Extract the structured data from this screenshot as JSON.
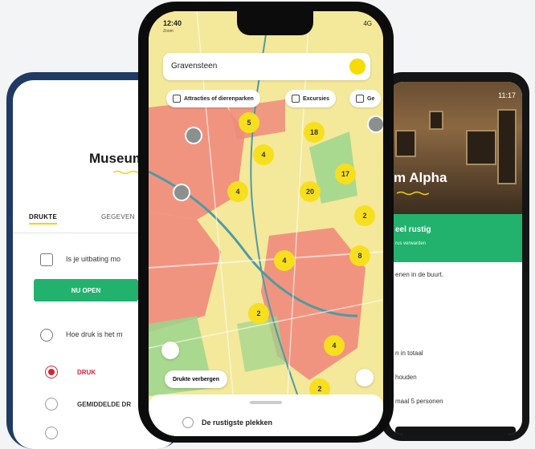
{
  "left_app": {
    "title": "Museum",
    "tabs": [
      {
        "label": "DRUKTE"
      },
      {
        "label": "GEGEVEN"
      }
    ],
    "operator_question": "Is je uitbating mo",
    "open_button": "NU OPEN",
    "crowd_question": "Hoe druk is het m",
    "options": [
      {
        "label": "DRUK"
      },
      {
        "label": "GEMIDDELDE DR"
      }
    ]
  },
  "center_app": {
    "status": {
      "time": "12:40",
      "sub": "Zoom",
      "signal": "4G"
    },
    "search": {
      "value": "Gravensteen"
    },
    "chips": [
      {
        "label": "Attracties of dierenparken"
      },
      {
        "label": "Excursies"
      },
      {
        "label": "Ge"
      }
    ],
    "clusters": [
      "5",
      "18",
      "4",
      "17",
      "4",
      "20",
      "2",
      "4",
      "8",
      "2",
      "4",
      "2"
    ],
    "toggle_label": "Drukte verbergen",
    "sheet_title": "De rustigste plekken"
  },
  "right_app": {
    "status_time": "11:17",
    "museum_name": "m Alpha",
    "banner_title": "eel rustig",
    "banner_sub": "rus verwarden",
    "line1": "enen in de buurt.",
    "line2": "n in totaal",
    "line3": "houden",
    "line4": "maal 5 personen"
  },
  "colors": {
    "accent": "#f7df1e",
    "green": "#22b26e",
    "busy_red": "#ef8b7d",
    "calm_yellow": "#f4e89a"
  }
}
